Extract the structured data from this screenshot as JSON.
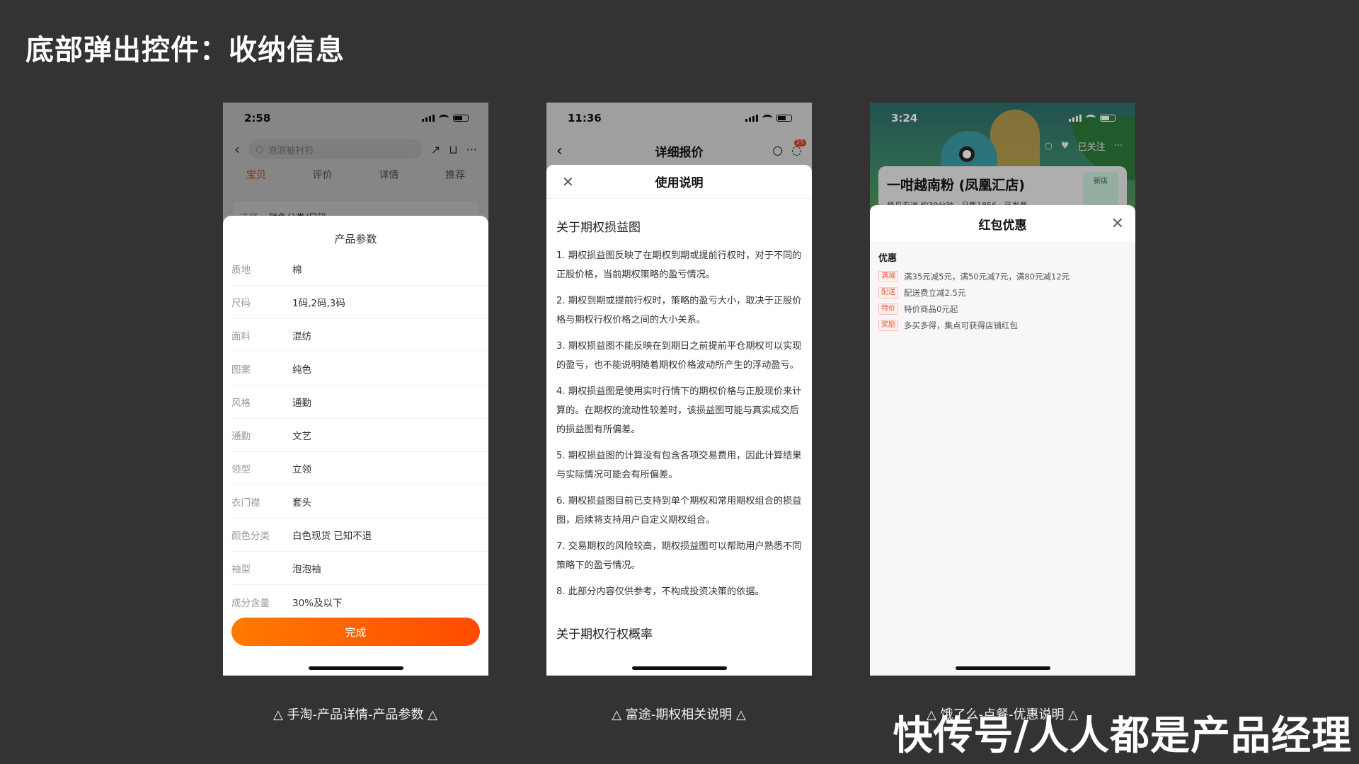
{
  "slide": {
    "title": "底部弹出控件：收纳信息",
    "watermark": "快传号/人人都是产品经理"
  },
  "phone1": {
    "time": "2:58",
    "search_placeholder": "泡泡袖衬衫",
    "tabs": [
      "宝贝",
      "评价",
      "详情",
      "推荐"
    ],
    "select_label": "选择",
    "select_value": "颜色分类/尺码",
    "sheet_title": "产品参数",
    "params": [
      {
        "k": "质地",
        "v": "棉"
      },
      {
        "k": "尺码",
        "v": "1码,2码,3码"
      },
      {
        "k": "面料",
        "v": "混纺"
      },
      {
        "k": "图案",
        "v": "纯色"
      },
      {
        "k": "风格",
        "v": "通勤"
      },
      {
        "k": "通勤",
        "v": "文艺"
      },
      {
        "k": "领型",
        "v": "立领"
      },
      {
        "k": "衣门襟",
        "v": "套头"
      },
      {
        "k": "颜色分类",
        "v": "白色现货 已知不退"
      },
      {
        "k": "袖型",
        "v": "泡泡袖"
      },
      {
        "k": "成分含量",
        "v": "30%及以下"
      }
    ],
    "done_label": "完成",
    "caption": "△ 手淘-产品详情-产品参数 △"
  },
  "phone2": {
    "time": "11:36",
    "nav_title": "详细报价",
    "badge": "25",
    "sheet_title": "使用说明",
    "section_title": "关于期权损益图",
    "paragraphs": [
      "1. 期权损益图反映了在期权到期或提前行权时，对于不同的正股价格，当前期权策略的盈亏情况。",
      "2. 期权到期或提前行权时，策略的盈亏大小，取决于正股价格与期权行权价格之间的大小关系。",
      "3. 期权损益图不能反映在到期日之前提前平仓期权可以实现的盈亏，也不能说明随着期权价格波动所产生的浮动盈亏。",
      "4. 期权损益图是使用实时行情下的期权价格与正股现价来计算的。在期权的流动性较差时，该损益图可能与真实成交后的损益图有所偏差。",
      "5. 期权损益图的计算没有包含各项交易费用，因此计算结果与实际情况可能会有所偏差。",
      "6. 期权损益图目前已支持到单个期权和常用期权组合的损益图，后续将支持用户自定义期权组合。",
      "7. 交易期权的风险较高，期权损益图可以帮助用户熟悉不同策略下的盈亏情况。",
      "8. 此部分内容仅供参考，不构成投资决策的依据。"
    ],
    "section_title2": "关于期权行权概率",
    "caption": "△ 富途-期权相关说明 △"
  },
  "phone3": {
    "time": "3:24",
    "follow_label": "已关注",
    "store_name": "一咁越南粉 (凤凰汇店)",
    "store_meta": "蜂鸟专送  约30分钟 · 月售1856 · 开发票",
    "store_tag": "新店",
    "sheet_title": "红包优惠",
    "promo_head": "优惠",
    "promos": [
      {
        "tag": "满减",
        "text": "满35元减5元，满50元减7元，满80元减12元"
      },
      {
        "tag": "配送",
        "text": "配送费立减2.5元"
      },
      {
        "tag": "特价",
        "text": "特价商品0元起"
      },
      {
        "tag": "奖励",
        "text": "多买多得，集点可获得店铺红包"
      }
    ],
    "caption": "△ 饿了么-点餐-优惠说明 △"
  }
}
